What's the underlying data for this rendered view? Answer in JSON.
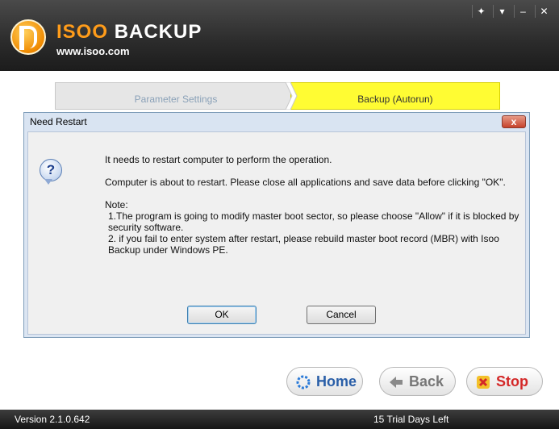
{
  "app": {
    "brand_prefix": "ISOO",
    "brand_suffix": "BACKUP",
    "url": "www.isoo.com"
  },
  "window_controls": [
    "pin-icon",
    "menu-icon",
    "minimize-icon",
    "close-icon"
  ],
  "tabs": {
    "parameter_settings": "Parameter Settings",
    "backup_autorun": "Backup (Autorun)"
  },
  "dialog": {
    "title": "Need Restart",
    "close_label": "x",
    "line1": "It needs to restart computer to perform the operation.",
    "line2": "Computer is about to restart. Please close all applications and save data before clicking \"OK\".",
    "note_label": "Note:",
    "note1": "1.The program is going to modify master boot sector, so please choose \"Allow\" if it is blocked by security software.",
    "note2": "2. if you fail to enter system after restart, please rebuild master boot record (MBR) with Isoo Backup under Windows PE.",
    "ok_label": "OK",
    "cancel_label": "Cancel"
  },
  "nav": {
    "home_label": "Home",
    "back_label": "Back",
    "stop_label": "Stop"
  },
  "status": {
    "version": "Version 2.1.0.642",
    "trial": "15 Trial Days Left"
  },
  "colors": {
    "active_tab": "#fffc33",
    "header_bg": "#2b2b2b",
    "brand_accent": "#ff9c1a"
  }
}
